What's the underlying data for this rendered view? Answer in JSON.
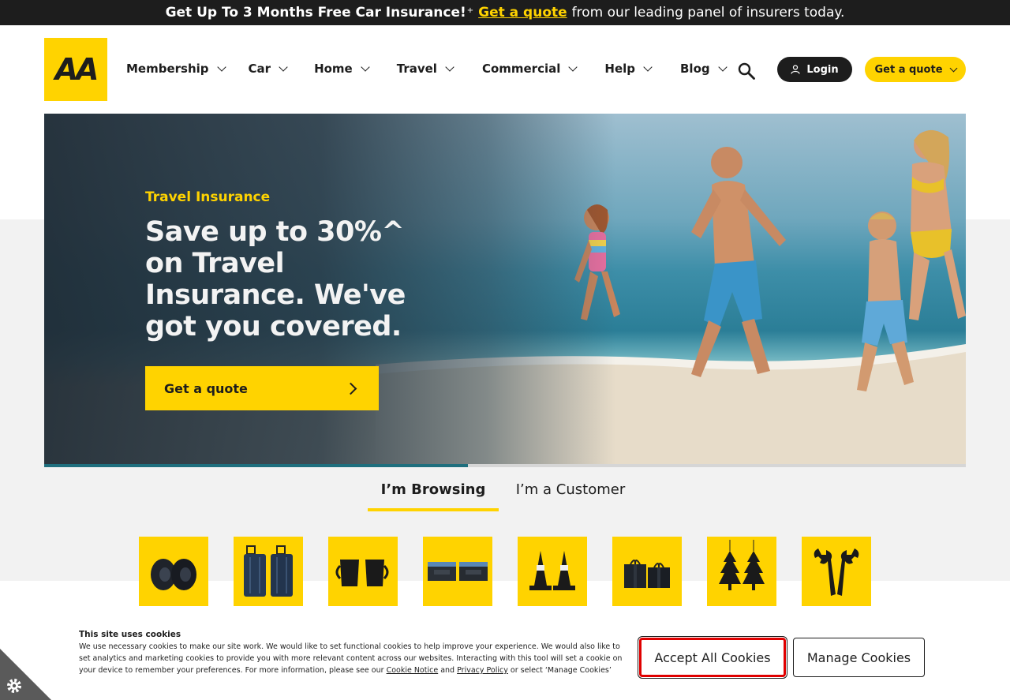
{
  "colors": {
    "brand_yellow": "#ffd300",
    "dark": "#1d1d1d",
    "progress": "#1f6f7e",
    "accept_border": "#e00000"
  },
  "promo": {
    "lead": "Get Up To 3 Months Free Car Insurance!",
    "sup": "+",
    "link": "Get a quote",
    "tail": "from our leading panel of insurers today."
  },
  "header": {
    "logo_text": "AA",
    "nav": [
      {
        "label": "Membership",
        "icon": "chevron-down-icon"
      },
      {
        "label": "Car",
        "icon": "chevron-down-icon"
      },
      {
        "label": "Home",
        "icon": "chevron-down-icon"
      },
      {
        "label": "Travel",
        "icon": "chevron-down-icon"
      },
      {
        "label": "Commercial",
        "icon": "chevron-down-icon"
      },
      {
        "label": "Help",
        "icon": "chevron-down-icon"
      },
      {
        "label": "Blog",
        "icon": "chevron-down-icon"
      }
    ],
    "search_icon": "search-icon",
    "login_label": "Login",
    "quote_label": "Get a quote"
  },
  "hero": {
    "eyebrow": "Travel Insurance",
    "title": "Save up to 30%^ on Travel Insurance. We've got you covered.",
    "cta_label": "Get a quote",
    "carousel_progress": 0.46
  },
  "tabs": [
    {
      "label": "I’m Browsing",
      "active": true
    },
    {
      "label": "I’m a Customer",
      "active": false
    }
  ],
  "tiles": [
    {
      "icon": "tyres-icon"
    },
    {
      "icon": "suitcases-icon"
    },
    {
      "icon": "mugs-icon"
    },
    {
      "icon": "storage-boxes-icon"
    },
    {
      "icon": "traffic-cones-icon"
    },
    {
      "icon": "gift-boxes-icon"
    },
    {
      "icon": "air-fresheners-icon"
    },
    {
      "icon": "spanners-icon"
    }
  ],
  "cookie": {
    "title": "This site uses cookies",
    "body": "We use necessary cookies to make our site work. We would like to set functional cookies to help improve your experience. We would also like to set analytics and marketing cookies to provide you with more relevant content across our websites. Interacting with this tool will set a cookie on your device to remember your preferences. For more information, please see our",
    "link1": "Cookie Notice",
    "and": "and",
    "link2": "Privacy Policy",
    "tail": "or select ‘Manage Cookies’",
    "accept_label": "Accept All Cookies",
    "manage_label": "Manage Cookies",
    "settings_icon": "cookie-settings-icon"
  }
}
